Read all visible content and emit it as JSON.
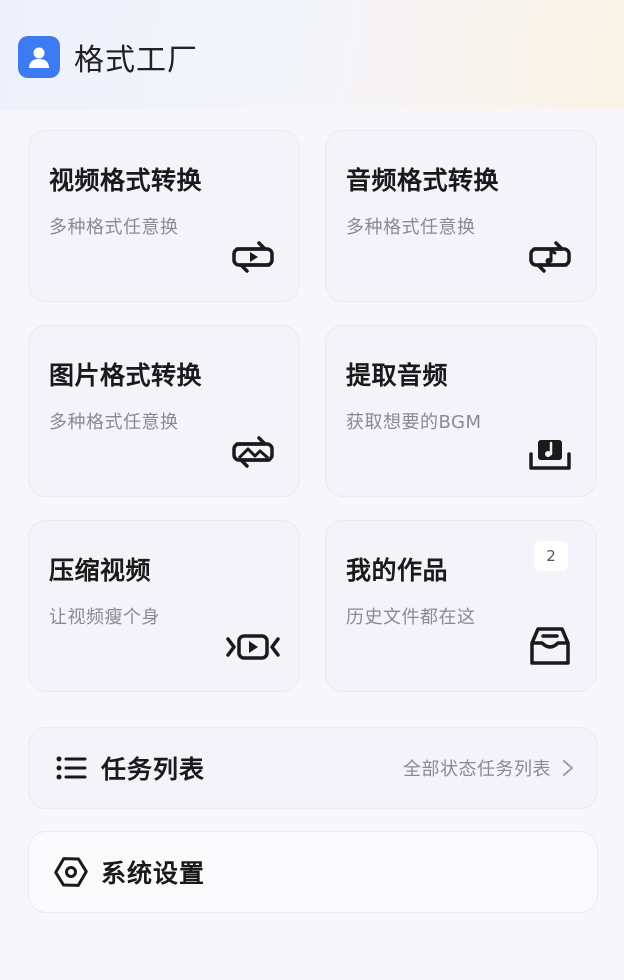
{
  "app": {
    "title": "格式工厂",
    "logo_icon": "user-avatar-icon",
    "accent": "#3d7bf5"
  },
  "cards": [
    {
      "title": "视频格式转换",
      "subtitle": "多种格式任意换",
      "icon": "video-convert-icon"
    },
    {
      "title": "音频格式转换",
      "subtitle": "多种格式任意换",
      "icon": "audio-convert-icon"
    },
    {
      "title": "图片格式转换",
      "subtitle": "多种格式任意换",
      "icon": "image-convert-icon"
    },
    {
      "title": "提取音频",
      "subtitle": "获取想要的BGM",
      "icon": "extract-audio-icon"
    },
    {
      "title": "压缩视频",
      "subtitle": "让视频瘦个身",
      "icon": "compress-video-icon"
    },
    {
      "title": "我的作品",
      "subtitle": "历史文件都在这",
      "icon": "my-works-icon",
      "badge": "2"
    }
  ],
  "task_list": {
    "label": "任务列表",
    "hint": "全部状态任务列表",
    "icon": "list-icon"
  },
  "settings": {
    "label": "系统设置",
    "icon": "settings-hexagon-icon"
  }
}
